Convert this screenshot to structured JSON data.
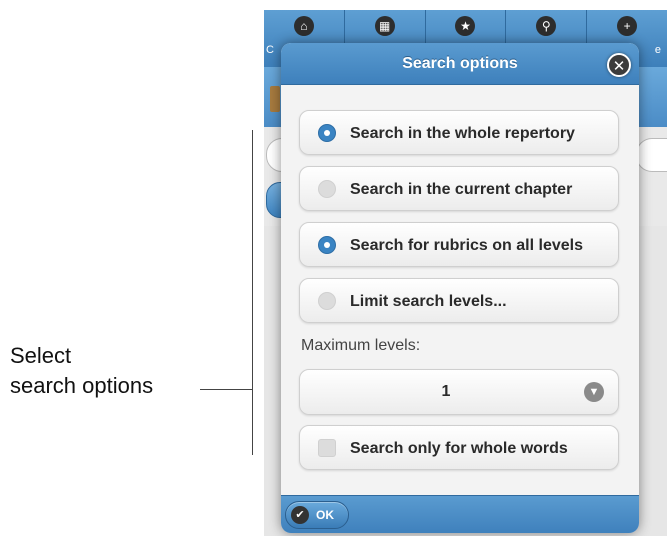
{
  "annotation": {
    "line1": "Select",
    "line2": "search options"
  },
  "background_app": {
    "tabs": [
      {
        "icon": "home-icon",
        "glyph": "⌂",
        "label_fragment": "C"
      },
      {
        "icon": "grid-icon",
        "glyph": "▦",
        "label_fragment": ""
      },
      {
        "icon": "star-icon",
        "glyph": "★",
        "label_fragment": ""
      },
      {
        "icon": "search-icon",
        "glyph": "⚲",
        "label_fragment": ""
      },
      {
        "icon": "plus-icon",
        "glyph": "+",
        "label_fragment": "e"
      }
    ]
  },
  "dialog": {
    "title": "Search options",
    "close_icon": "close-icon",
    "options": [
      {
        "label": "Search in the whole repertory",
        "selected": true
      },
      {
        "label": "Search in the current chapter",
        "selected": false
      },
      {
        "label": "Search for rubrics on all levels",
        "selected": true
      },
      {
        "label": "Limit search levels...",
        "selected": false
      }
    ],
    "max_levels_label": "Maximum levels:",
    "max_levels_value": "1",
    "whole_words_label": "Search only for whole words",
    "whole_words_checked": false,
    "ok_label": "OK"
  },
  "colors": {
    "accent_blue": "#3e80bc",
    "radio_on": "#3a84c3"
  }
}
